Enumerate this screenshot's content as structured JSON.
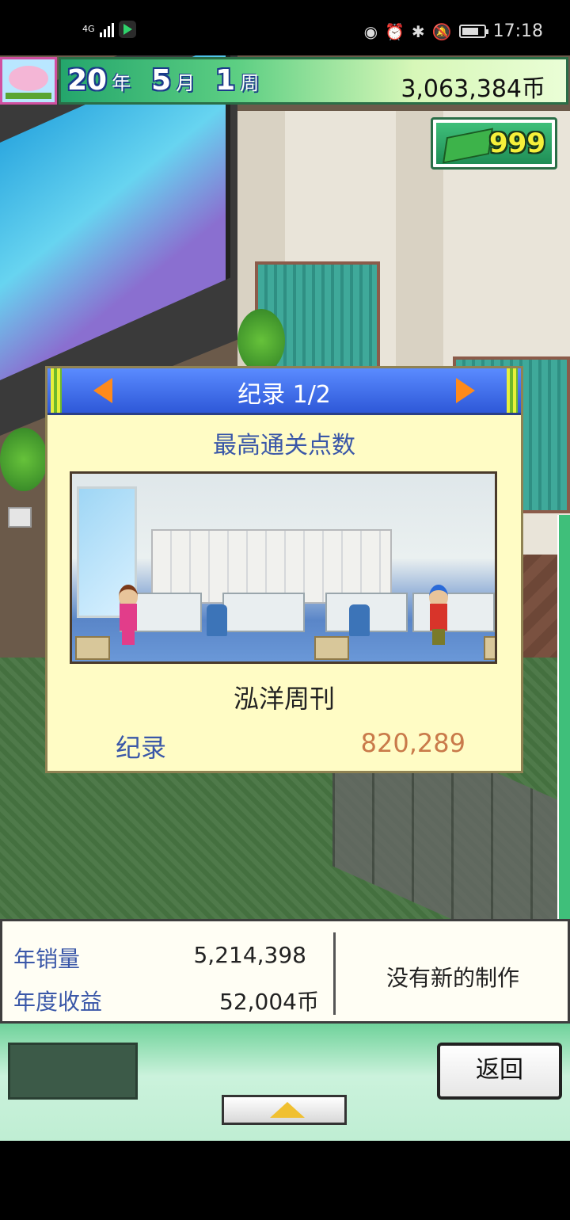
{
  "status_bar": {
    "network": "4G",
    "time": "17:18",
    "icons": [
      "eye-icon",
      "alarm-icon",
      "bluetooth-icon",
      "mute-icon"
    ],
    "battery_level": 0.8
  },
  "hud": {
    "year_num": "20",
    "year_unit": "年",
    "month_num": "5",
    "month_unit": "月",
    "week_num": "1",
    "week_unit": "周",
    "money": "3,063,384币",
    "tickets": "999"
  },
  "dialog": {
    "title": "纪录 1/2",
    "subtitle": "最高通关点数",
    "magazine_name": "泓洋周刊",
    "record_label": "纪录",
    "record_value": "820,289"
  },
  "stats": {
    "annual_sales_label": "年销量",
    "annual_sales_value": "5,214,398",
    "annual_revenue_label": "年度收益",
    "annual_revenue_value": "52,004币",
    "no_new_production": "没有新的制作"
  },
  "bottom": {
    "back_label": "返回"
  },
  "colors": {
    "accent_blue": "#3a57a8",
    "record_value": "#c97a4a",
    "hud_green": "#24a66c",
    "dialog_bg": "#fffcc5"
  }
}
